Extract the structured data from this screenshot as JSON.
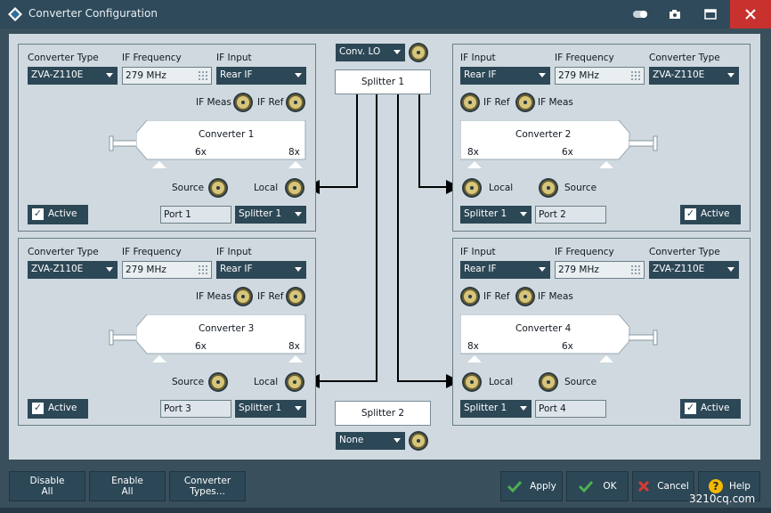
{
  "window": {
    "title": "Converter Configuration"
  },
  "converters": [
    {
      "name": "Converter 1",
      "type": "ZVA-Z110E",
      "if_frequency": "279 MHz",
      "if_input": "Rear IF",
      "port": "Port 1",
      "splitter": "Splitter 1",
      "active_label": "Active",
      "mult_left": "6x",
      "mult_right": "8x"
    },
    {
      "name": "Converter 2",
      "type": "ZVA-Z110E",
      "if_frequency": "279 MHz",
      "if_input": "Rear IF",
      "port": "Port 2",
      "splitter": "Splitter 1",
      "active_label": "Active",
      "mult_left": "8x",
      "mult_right": "6x"
    },
    {
      "name": "Converter 3",
      "type": "ZVA-Z110E",
      "if_frequency": "279 MHz",
      "if_input": "Rear IF",
      "port": "Port 3",
      "splitter": "Splitter 1",
      "active_label": "Active",
      "mult_left": "6x",
      "mult_right": "8x"
    },
    {
      "name": "Converter 4",
      "type": "ZVA-Z110E",
      "if_frequency": "279 MHz",
      "if_input": "Rear IF",
      "port": "Port 4",
      "splitter": "Splitter 1",
      "active_label": "Active",
      "mult_left": "8x",
      "mult_right": "6x"
    }
  ],
  "labels": {
    "converter_type": "Converter Type",
    "if_frequency": "IF Frequency",
    "if_input": "IF Input",
    "if_meas": "IF Meas",
    "if_ref": "IF Ref",
    "source": "Source",
    "local": "Local"
  },
  "center": {
    "conv_lo": "Conv. LO",
    "splitter1": "Splitter 1",
    "splitter2": "Splitter 2",
    "splitter2_source": "None"
  },
  "buttons": {
    "disable_all": "Disable All",
    "enable_all": "Enable All",
    "converter_types": "Converter Types...",
    "apply": "Apply",
    "ok": "OK",
    "cancel": "Cancel",
    "help": "Help"
  },
  "watermark": "3210cq.com",
  "colors": {
    "accent_green": "#4caf50",
    "cancel_red": "#d63a35",
    "help_yellow": "#f5b800"
  }
}
